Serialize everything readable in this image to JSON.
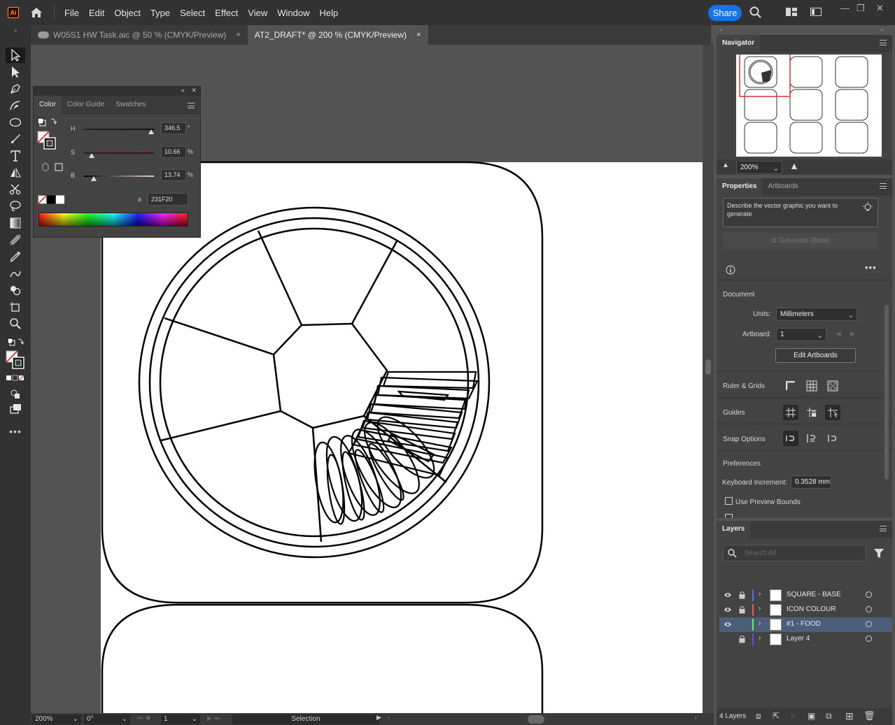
{
  "app": {
    "logo_text": "Ai"
  },
  "menu": [
    "File",
    "Edit",
    "Object",
    "Type",
    "Select",
    "Effect",
    "View",
    "Window",
    "Help"
  ],
  "share_label": "Share",
  "tabs": [
    {
      "label": "W05S1 HW Task.aic @ 50 % (CMYK/Preview)",
      "close": "×",
      "active": false
    },
    {
      "label": "AT2_DRAFT* @ 200 % (CMYK/Preview)",
      "close": "×",
      "active": true
    }
  ],
  "color_panel": {
    "tabs": [
      "Color",
      "Color Guide",
      "Swatches"
    ],
    "h": {
      "label": "H",
      "value": "346.5",
      "unit": "°",
      "level": 0.96
    },
    "s": {
      "label": "S",
      "value": "10.66",
      "unit": "%",
      "level": 0.1066
    },
    "b": {
      "label": "B",
      "value": "13.74",
      "unit": "%",
      "level": 0.1374
    },
    "hex_label": "#",
    "hex_value": "231F20"
  },
  "navigator": {
    "title": "Navigator",
    "zoom": "200%"
  },
  "properties": {
    "tabs": [
      "Properties",
      "Artboards"
    ],
    "generate_placeholder": "Describe the vector graphic you want to generate",
    "generate_button": "Generate (Beta)",
    "document_label": "Document",
    "units_label": "Units:",
    "units_value": "Millimeters",
    "artboard_label": "Artboard:",
    "artboard_value": "1",
    "edit_artboards": "Edit Artboards",
    "ruler_grids": "Ruler & Grids",
    "guides": "Guides",
    "snap_options": "Snap Options",
    "preferences": "Preferences",
    "keyboard_increment_label": "Keyboard Increment:",
    "keyboard_increment_value": "0.3528 mm",
    "use_preview_bounds": "Use Preview Bounds"
  },
  "layers": {
    "title": "Layers",
    "search_placeholder": "Search All",
    "items": [
      {
        "name": "SQUARE - BASE",
        "color": "#4f6cff",
        "locked": true,
        "visible": true,
        "selected": false
      },
      {
        "name": "ICON COLOUR",
        "color": "#ff4f4f",
        "locked": true,
        "visible": true,
        "selected": false
      },
      {
        "name": "#1 - FOOD",
        "color": "#4fff4f",
        "locked": false,
        "visible": true,
        "selected": true
      },
      {
        "name": "Layer 4",
        "color": "#4f4fff",
        "locked": true,
        "visible": false,
        "selected": false
      }
    ],
    "count": "4 Layers"
  },
  "status": {
    "zoom": "200%",
    "rotation": "0°",
    "artboard": "1",
    "tool": "Selection"
  }
}
